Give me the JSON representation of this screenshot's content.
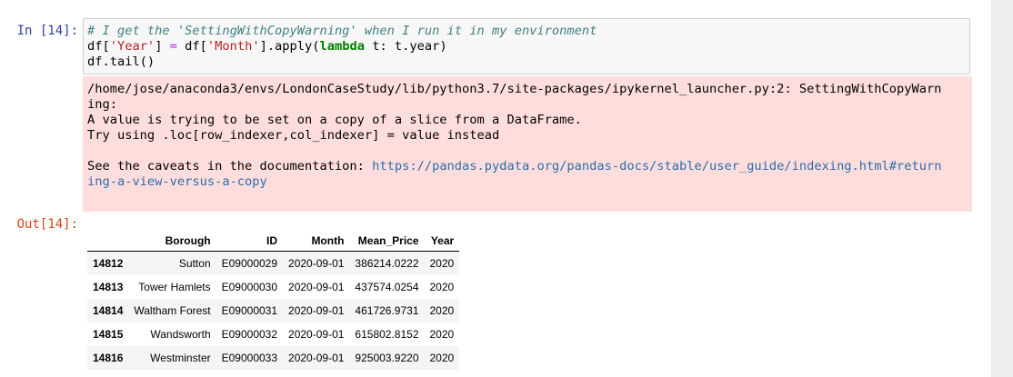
{
  "prompts": {
    "input": "In [14]:",
    "output": "Out[14]:"
  },
  "code": {
    "line1_comment": "# I get the 'SettingWithCopyWarning' when I run it in my environment",
    "line2_df": "df[",
    "line2_str1": "'Year'",
    "line2_mid": "] ",
    "line2_eq": "=",
    "line2_df2": " df[",
    "line2_str2": "'Month'",
    "line2_apply": "].apply(",
    "line2_kw": "lambda",
    "line2_end": " t: t.year)",
    "line3": "df.tail()"
  },
  "warning": {
    "line1": "/home/jose/anaconda3/envs/LondonCaseStudy/lib/python3.7/site-packages/ipykernel_launcher.py:2: SettingWithCopyWarn",
    "line2": "ing:",
    "line3": "A value is trying to be set on a copy of a slice from a DataFrame.",
    "line4": "Try using .loc[row_indexer,col_indexer] = value instead",
    "line5_prefix": "See the caveats in the documentation: ",
    "link_part1": "https://pandas.pydata.org/pandas-docs/stable/user_guide/indexing.html#return",
    "link_part2": "ing-a-view-versus-a-copy"
  },
  "dataframe": {
    "columns": [
      "",
      "Borough",
      "ID",
      "Month",
      "Mean_Price",
      "Year"
    ],
    "rows": [
      {
        "index": "14812",
        "Borough": "Sutton",
        "ID": "E09000029",
        "Month": "2020-09-01",
        "Mean_Price": "386214.0222",
        "Year": "2020"
      },
      {
        "index": "14813",
        "Borough": "Tower Hamlets",
        "ID": "E09000030",
        "Month": "2020-09-01",
        "Mean_Price": "437574.0254",
        "Year": "2020"
      },
      {
        "index": "14814",
        "Borough": "Waltham Forest",
        "ID": "E09000031",
        "Month": "2020-09-01",
        "Mean_Price": "461726.9731",
        "Year": "2020"
      },
      {
        "index": "14815",
        "Borough": "Wandsworth",
        "ID": "E09000032",
        "Month": "2020-09-01",
        "Mean_Price": "615802.8152",
        "Year": "2020"
      },
      {
        "index": "14816",
        "Borough": "Westminster",
        "ID": "E09000033",
        "Month": "2020-09-01",
        "Mean_Price": "925003.9220",
        "Year": "2020"
      }
    ]
  }
}
